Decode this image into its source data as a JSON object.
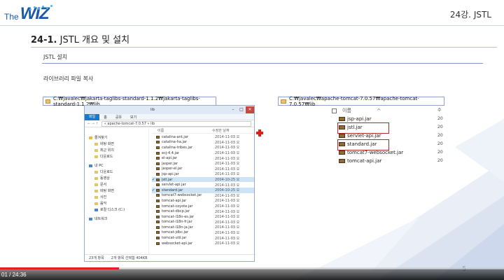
{
  "header": {
    "logo_the": "The",
    "logo_wiz": "WIZ",
    "lecture": "24강. JSTL"
  },
  "section": {
    "number": "24-1.",
    "title": " JSTL 개요 및 설치"
  },
  "subsection": "JSTL 설치",
  "caption": "라이브러리 파일 복사",
  "paths": {
    "left": "C:₩javalec₩jakarta-taglibs-standard-1.1.2₩jakarta-taglibs-standard-1.1.2₩lib",
    "right": "C:₩javalec₩apache-tomcat-7.0.57₩apache-tomcat-7.0.57₩lib"
  },
  "explorer": {
    "title": "lib",
    "ribbon": [
      "파일",
      "홈",
      "공유",
      "보기"
    ],
    "breadcrumb": "« apache-tomcat-7.0.57 » lib",
    "nav": [
      {
        "label": "즐겨찾기",
        "group": true,
        "icon": "star-icon"
      },
      {
        "label": "바탕 화면",
        "group": false,
        "icon": "folder-icon"
      },
      {
        "label": "최근 위치",
        "group": false,
        "icon": "folder-icon"
      },
      {
        "label": "다운로드",
        "group": false,
        "icon": "folder-icon"
      },
      {
        "label": "내 PC",
        "group": true,
        "icon": "pc-icon"
      },
      {
        "label": "다운로드",
        "group": false,
        "icon": "folder-icon"
      },
      {
        "label": "동영상",
        "group": false,
        "icon": "folder-icon"
      },
      {
        "label": "문서",
        "group": false,
        "icon": "folder-icon"
      },
      {
        "label": "바탕 화면",
        "group": false,
        "icon": "folder-icon"
      },
      {
        "label": "사진",
        "group": false,
        "icon": "folder-icon"
      },
      {
        "label": "음악",
        "group": false,
        "icon": "folder-icon"
      },
      {
        "label": "로컬 디스크 (C:)",
        "group": false,
        "icon": "disk-icon"
      },
      {
        "label": "네트워크",
        "group": true,
        "icon": "network-icon"
      }
    ],
    "col_name": "이름",
    "col_date": "수정한 날짜",
    "files": [
      {
        "name": "catalina-ant.jar",
        "date": "2014-11-03 오",
        "checked": false
      },
      {
        "name": "catalina-ha.jar",
        "date": "2014-11-03 오",
        "checked": false
      },
      {
        "name": "catalina-tribes.jar",
        "date": "2014-11-03 오",
        "checked": false
      },
      {
        "name": "ecj-4.4.jar",
        "date": "2014-11-03 오",
        "checked": false
      },
      {
        "name": "el-api.jar",
        "date": "2014-11-03 오",
        "checked": false
      },
      {
        "name": "jasper.jar",
        "date": "2014-11-03 오",
        "checked": false
      },
      {
        "name": "jasper-el.jar",
        "date": "2014-11-03 오",
        "checked": false
      },
      {
        "name": "jsp-api.jar",
        "date": "2014-11-03 오",
        "checked": false
      },
      {
        "name": "jstl.jar",
        "date": "2004-10-25 오",
        "checked": true
      },
      {
        "name": "servlet-api.jar",
        "date": "2014-11-03 오",
        "checked": false
      },
      {
        "name": "standard.jar",
        "date": "2004-10-25 오",
        "checked": true
      },
      {
        "name": "tomcat7-websocket.jar",
        "date": "2014-11-03 오",
        "checked": false
      },
      {
        "name": "tomcat-api.jar",
        "date": "2014-11-03 오",
        "checked": false
      },
      {
        "name": "tomcat-coyote.jar",
        "date": "2014-11-03 오",
        "checked": false
      },
      {
        "name": "tomcat-dbcp.jar",
        "date": "2014-11-03 오",
        "checked": false
      },
      {
        "name": "tomcat-i18n-es.jar",
        "date": "2014-11-03 오",
        "checked": false
      },
      {
        "name": "tomcat-i18n-fr.jar",
        "date": "2014-11-03 오",
        "checked": false
      },
      {
        "name": "tomcat-i18n-ja.jar",
        "date": "2014-11-03 오",
        "checked": false
      },
      {
        "name": "tomcat-jdbc.jar",
        "date": "2014-11-03 오",
        "checked": false
      },
      {
        "name": "tomcat-util.jar",
        "date": "2014-11-03 오",
        "checked": false
      },
      {
        "name": "websocket-api.jar",
        "date": "2014-11-03 오",
        "checked": false
      }
    ],
    "status_count": "23개 항목",
    "status_selected": "2개 항목 선택함 404KB"
  },
  "right_list": {
    "col_name": "이름",
    "files": [
      {
        "name": "jsp-api.jar",
        "highlight": false,
        "date": "20"
      },
      {
        "name": "jstl.jar",
        "highlight": true,
        "date": "20"
      },
      {
        "name": "servlet-api.jar",
        "highlight": false,
        "date": "20"
      },
      {
        "name": "standard.jar",
        "highlight": true,
        "date": "20"
      },
      {
        "name": "tomcat7-websocket.jar",
        "highlight": false,
        "date": "20"
      },
      {
        "name": "tomcat-api.jar",
        "highlight": false,
        "date": "20"
      }
    ],
    "col_head": "수"
  },
  "page_number": "5",
  "video": {
    "time": "01 / 24:36",
    "progress": 0.236
  },
  "colors": {
    "brand": "#1a5aa8",
    "highlight_box": "#b02a2a",
    "progress": "#e52020"
  }
}
